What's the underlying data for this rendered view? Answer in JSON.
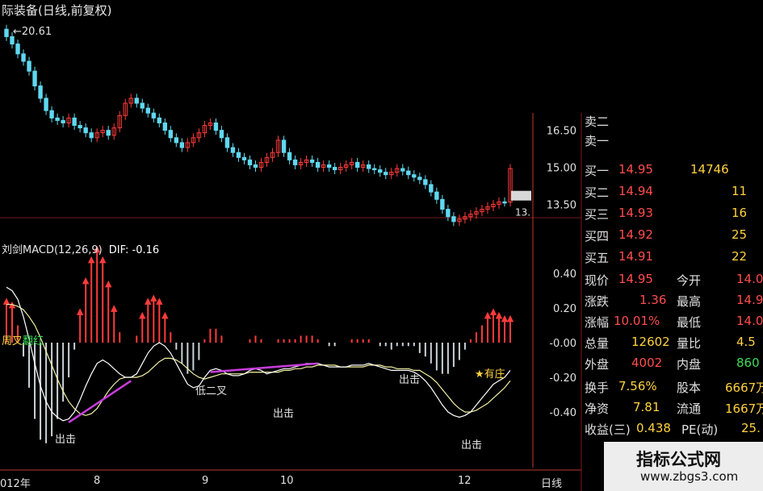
{
  "header": {
    "title": "际装备(日线,前复权)",
    "max_label": "20.61"
  },
  "indicator": {
    "title": "刘剑MACD(12,26,9)",
    "dif_label": "DIF: -0.16"
  },
  "price_axis": [
    "16.50",
    "15.00",
    "13.50"
  ],
  "last_price_tag": "13.",
  "macd_axis": [
    "0.40",
    "0.20",
    "-0.00",
    "-0.20",
    "-0.40"
  ],
  "x_labels": [
    "012年",
    "8",
    "9",
    "10",
    "12",
    "日线"
  ],
  "annotations": [
    "周叉",
    "翻红",
    "出击",
    "低二叉",
    "出击",
    "出击",
    "出击",
    "★有庄"
  ],
  "order_book": {
    "sells": [
      {
        "label": "卖二"
      },
      {
        "label": "卖一"
      }
    ],
    "buys": [
      {
        "label": "买一",
        "price": "14.95",
        "volume": "14746"
      },
      {
        "label": "买二",
        "price": "14.94",
        "volume": "11"
      },
      {
        "label": "买三",
        "price": "14.93",
        "volume": "16"
      },
      {
        "label": "买四",
        "price": "14.92",
        "volume": "25"
      },
      {
        "label": "买五",
        "price": "14.91",
        "volume": "22"
      }
    ]
  },
  "quote": [
    {
      "label": "现价",
      "value": "14.95",
      "label2": "今开",
      "value2": "14.0"
    },
    {
      "label": "涨跌",
      "value": "1.36",
      "label2": "最高",
      "value2": "14.9"
    },
    {
      "label": "涨幅",
      "value": "10.01%",
      "label2": "最低",
      "value2": "14.0"
    },
    {
      "label": "总量",
      "value": "12602",
      "label2": "量比",
      "value2": "4.5"
    },
    {
      "label": "外盘",
      "value": "4002",
      "label2": "内盘",
      "value2": "860"
    },
    {
      "label": "换手",
      "value": "7.56%",
      "label2": "股本",
      "value2": "6667万"
    },
    {
      "label": "净资",
      "value": "7.81",
      "label2": "流通",
      "value2": "1667万"
    },
    {
      "label": "收益(三)",
      "value": "0.438",
      "label2": "PE(动)",
      "value2": "25."
    }
  ],
  "watermark": {
    "cn": "指标公式网",
    "url": "www.zbgs3.com"
  },
  "colors": {
    "up": "#ff3b3b",
    "down": "#5fd8f0",
    "text": "#e0e0e0",
    "axis": "#c0392b",
    "gold": "#ffd23f",
    "magenta": "#c83cdc"
  },
  "chart_data": {
    "type": "candlestick",
    "title": "际装备(日线,前复权)",
    "ylim": [
      12.5,
      21.0
    ],
    "yticks": [
      16.5,
      15.0,
      13.5
    ],
    "annotated_high": 20.61,
    "last_price": 14.95,
    "x_month_labels": [
      "012年",
      "8",
      "9",
      "10",
      "12"
    ],
    "closes": [
      20.3,
      20.0,
      19.6,
      19.3,
      18.9,
      18.3,
      17.8,
      17.3,
      17.0,
      16.9,
      16.8,
      17.0,
      16.7,
      16.6,
      16.4,
      16.2,
      16.4,
      16.5,
      16.3,
      16.6,
      17.1,
      17.6,
      17.8,
      17.6,
      17.4,
      17.2,
      17.0,
      16.8,
      16.5,
      16.2,
      16.0,
      15.8,
      16.0,
      16.2,
      16.4,
      16.7,
      16.8,
      16.5,
      16.2,
      15.8,
      15.6,
      15.4,
      15.3,
      15.1,
      15.0,
      15.2,
      15.4,
      15.6,
      16.1,
      15.6,
      15.3,
      15.1,
      15.2,
      15.3,
      15.2,
      15.0,
      15.1,
      15.0,
      14.9,
      15.0,
      15.1,
      15.2,
      15.0,
      15.1,
      14.95,
      14.9,
      14.8,
      14.7,
      14.8,
      14.95,
      14.85,
      14.7,
      14.6,
      14.5,
      14.3,
      14.0,
      13.7,
      13.3,
      13.0,
      12.8,
      12.9,
      13.0,
      13.1,
      13.2,
      13.3,
      13.4,
      13.5,
      13.6,
      13.59,
      14.95
    ],
    "ind_title": "刘剑MACD(12,26,9)",
    "macd_ylim": [
      -0.6,
      0.5
    ],
    "macd_yticks": [
      0.4,
      0.2,
      0.0,
      -0.2,
      -0.4
    ],
    "dif": [
      0.32,
      0.3,
      0.25,
      0.15,
      0.02,
      -0.12,
      -0.25,
      -0.34,
      -0.4,
      -0.43,
      -0.45,
      -0.44,
      -0.4,
      -0.33,
      -0.25,
      -0.18,
      -0.12,
      -0.1,
      -0.12,
      -0.15,
      -0.18,
      -0.2,
      -0.2,
      -0.18,
      -0.12,
      -0.06,
      -0.02,
      0.0,
      -0.02,
      -0.06,
      -0.12,
      -0.18,
      -0.24,
      -0.26,
      -0.25,
      -0.2,
      -0.16,
      -0.15,
      -0.16,
      -0.18,
      -0.19,
      -0.19,
      -0.18,
      -0.16,
      -0.15,
      -0.16,
      -0.18,
      -0.17,
      -0.16,
      -0.15,
      -0.15,
      -0.14,
      -0.13,
      -0.12,
      -0.12,
      -0.12,
      -0.13,
      -0.14,
      -0.14,
      -0.14,
      -0.14,
      -0.13,
      -0.13,
      -0.13,
      -0.12,
      -0.13,
      -0.14,
      -0.15,
      -0.16,
      -0.16,
      -0.16,
      -0.16,
      -0.17,
      -0.19,
      -0.22,
      -0.26,
      -0.31,
      -0.36,
      -0.4,
      -0.42,
      -0.43,
      -0.42,
      -0.4,
      -0.36,
      -0.32,
      -0.28,
      -0.24,
      -0.22,
      -0.2,
      -0.16
    ],
    "dea": [
      0.22,
      0.22,
      0.21,
      0.19,
      0.15,
      0.1,
      0.03,
      -0.05,
      -0.13,
      -0.21,
      -0.28,
      -0.34,
      -0.38,
      -0.41,
      -0.42,
      -0.41,
      -0.38,
      -0.33,
      -0.28,
      -0.24,
      -0.21,
      -0.2,
      -0.2,
      -0.2,
      -0.19,
      -0.17,
      -0.14,
      -0.11,
      -0.09,
      -0.09,
      -0.1,
      -0.12,
      -0.15,
      -0.18,
      -0.2,
      -0.21,
      -0.2,
      -0.19,
      -0.18,
      -0.18,
      -0.18,
      -0.18,
      -0.18,
      -0.17,
      -0.17,
      -0.17,
      -0.17,
      -0.17,
      -0.17,
      -0.16,
      -0.16,
      -0.15,
      -0.15,
      -0.14,
      -0.14,
      -0.13,
      -0.13,
      -0.13,
      -0.13,
      -0.14,
      -0.14,
      -0.14,
      -0.14,
      -0.14,
      -0.13,
      -0.13,
      -0.13,
      -0.14,
      -0.14,
      -0.15,
      -0.15,
      -0.15,
      -0.16,
      -0.16,
      -0.18,
      -0.2,
      -0.23,
      -0.27,
      -0.31,
      -0.35,
      -0.38,
      -0.4,
      -0.4,
      -0.39,
      -0.37,
      -0.35,
      -0.32,
      -0.29,
      -0.26,
      -0.22
    ],
    "macd_bars": [
      0.22,
      0.2,
      0.1,
      -0.08,
      -0.26,
      -0.44,
      -0.56,
      -0.58,
      -0.54,
      -0.44,
      -0.34,
      -0.2,
      -0.04,
      0.16,
      0.34,
      0.46,
      0.52,
      0.46,
      0.32,
      0.18,
      0.06,
      0,
      0,
      0.04,
      0.14,
      0.22,
      0.24,
      0.22,
      0.14,
      0.06,
      -0.04,
      -0.12,
      -0.18,
      -0.16,
      -0.1,
      0.02,
      0.08,
      0.08,
      0.04,
      0,
      0,
      0,
      0,
      0.02,
      0.04,
      0.02,
      0,
      0,
      0.02,
      0.02,
      0.02,
      0.02,
      0.04,
      0.04,
      0.04,
      0.02,
      0,
      -0.02,
      -0.02,
      0,
      0,
      0.02,
      0.02,
      0.02,
      0.02,
      0,
      -0.02,
      -0.02,
      -0.04,
      -0.02,
      -0.02,
      -0.02,
      -0.02,
      -0.06,
      -0.08,
      -0.12,
      -0.16,
      -0.18,
      -0.18,
      -0.14,
      -0.1,
      -0.04,
      0.02,
      0.06,
      0.1,
      0.14,
      0.16,
      0.14,
      0.12,
      0.12
    ]
  }
}
